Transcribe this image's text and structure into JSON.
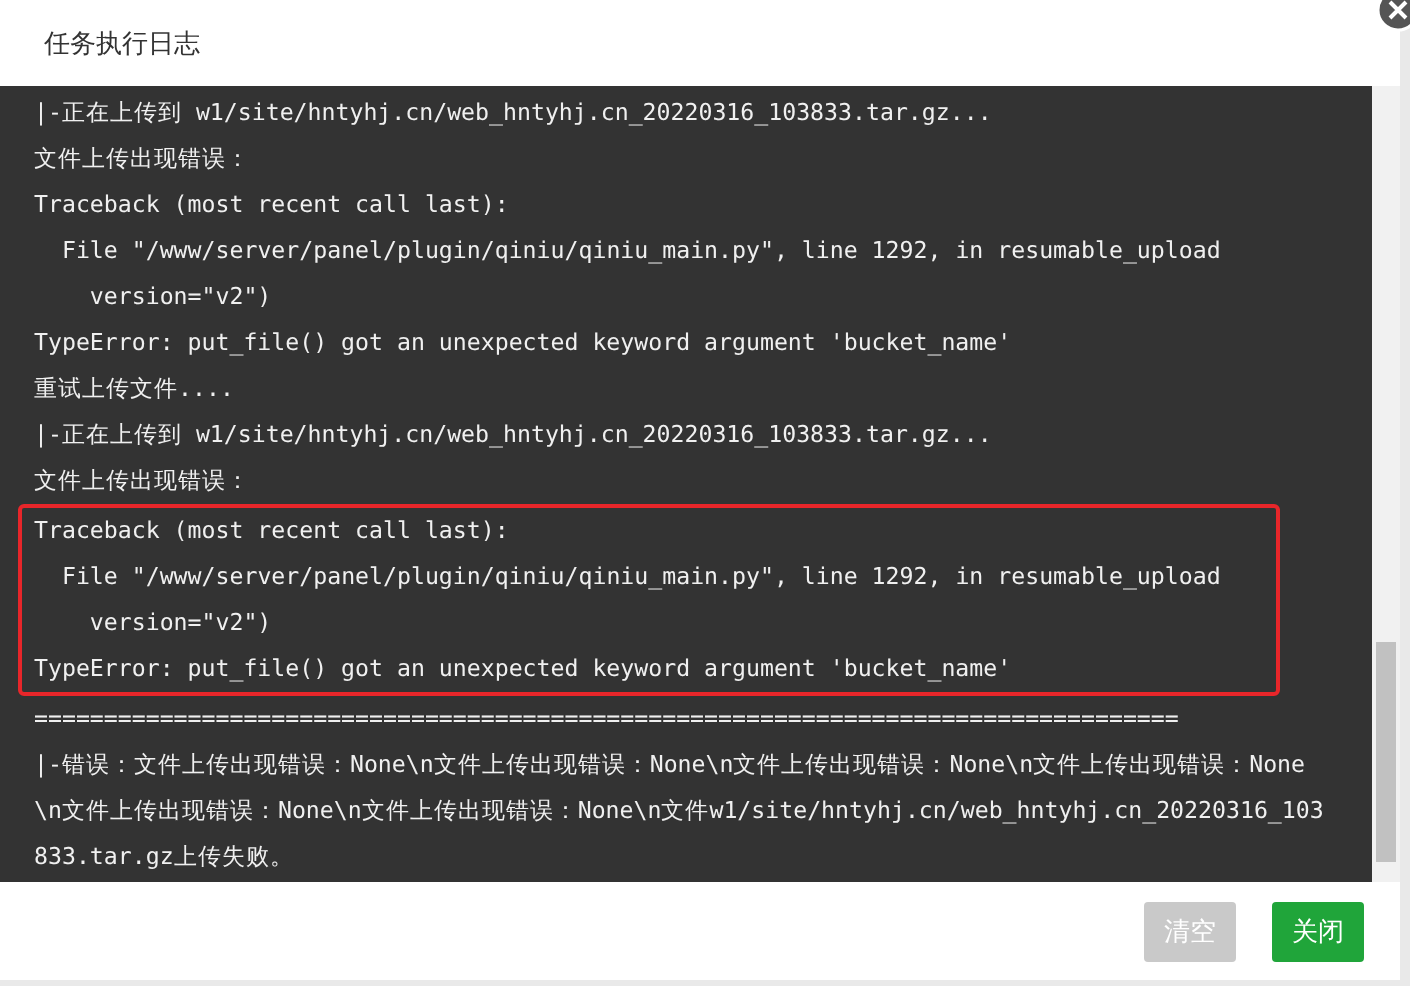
{
  "dialog": {
    "title": "任务执行日志"
  },
  "log": [
    {
      "text": "|-正在上传到 w1/site/hntyhj.cn/web_hntyhj.cn_20220316_103833.tar.gz...",
      "highlighted": false
    },
    {
      "text": "文件上传出现错误：",
      "highlighted": false
    },
    {
      "text": "Traceback (most recent call last):",
      "highlighted": false
    },
    {
      "text": "  File \"/www/server/panel/plugin/qiniu/qiniu_main.py\", line 1292, in resumable_upload",
      "highlighted": false
    },
    {
      "text": "    version=\"v2\")",
      "highlighted": false
    },
    {
      "text": "TypeError: put_file() got an unexpected keyword argument 'bucket_name'",
      "highlighted": false
    },
    {
      "text": "重试上传文件....",
      "highlighted": false
    },
    {
      "text": "|-正在上传到 w1/site/hntyhj.cn/web_hntyhj.cn_20220316_103833.tar.gz...",
      "highlighted": false
    },
    {
      "text": "文件上传出现错误：",
      "highlighted": false
    },
    {
      "text": "Traceback (most recent call last):",
      "highlighted": true
    },
    {
      "text": "  File \"/www/server/panel/plugin/qiniu/qiniu_main.py\", line 1292, in resumable_upload",
      "highlighted": true
    },
    {
      "text": "    version=\"v2\")",
      "highlighted": true
    },
    {
      "text": "TypeError: put_file() got an unexpected keyword argument 'bucket_name'",
      "highlighted": true
    },
    {
      "text": "==================================================================================",
      "highlighted": false
    },
    {
      "text": "|-错误：文件上传出现错误：None\\n文件上传出现错误：None\\n文件上传出现错误：None\\n文件上传出现错误：None\\n文件上传出现错误：None\\n文件上传出现错误：None\\n文件w1/site/hntyhj.cn/web_hntyhj.cn_20220316_103833.tar.gz上传失败。",
      "highlighted": false
    }
  ],
  "buttons": [
    {
      "label": "清空",
      "disabled": true
    },
    {
      "label": "关闭",
      "disabled": false
    }
  ]
}
